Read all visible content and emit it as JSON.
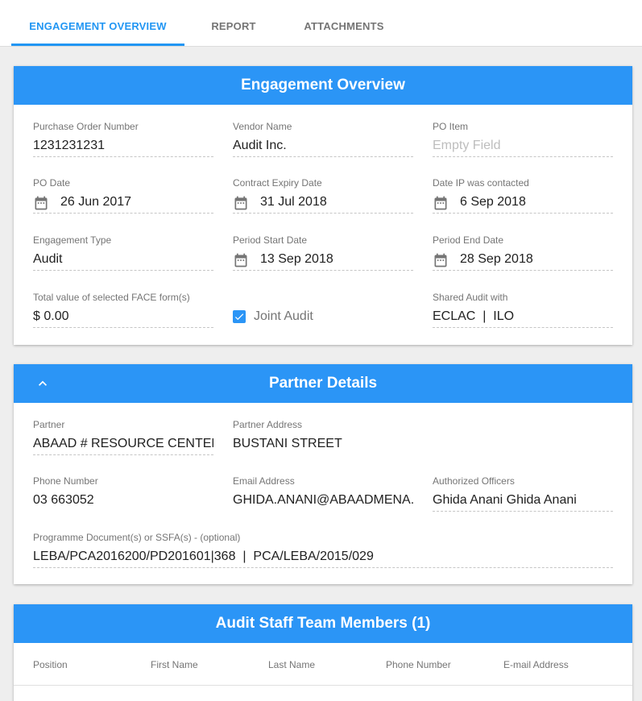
{
  "tabs": [
    {
      "label": "ENGAGEMENT OVERVIEW",
      "active": true
    },
    {
      "label": "REPORT",
      "active": false
    },
    {
      "label": "ATTACHMENTS",
      "active": false
    }
  ],
  "engagement": {
    "title": "Engagement Overview",
    "purchase_order": {
      "label": "Purchase Order Number",
      "value": "1231231231"
    },
    "vendor_name": {
      "label": "Vendor Name",
      "value": "Audit Inc."
    },
    "po_item": {
      "label": "PO Item",
      "placeholder": "Empty Field"
    },
    "po_date": {
      "label": "PO Date",
      "value": "26 Jun 2017"
    },
    "contract_expiry": {
      "label": "Contract Expiry Date",
      "value": "31 Jul 2018"
    },
    "date_ip_contacted": {
      "label": "Date IP was contacted",
      "value": "6 Sep 2018"
    },
    "engagement_type": {
      "label": "Engagement Type",
      "value": "Audit"
    },
    "period_start": {
      "label": "Period Start Date",
      "value": "13 Sep 2018"
    },
    "period_end": {
      "label": "Period End Date",
      "value": "28 Sep 2018"
    },
    "face_total": {
      "label": "Total value of selected FACE form(s)",
      "value": "$ 0.00"
    },
    "joint_audit": {
      "label": "Joint Audit",
      "checked": true
    },
    "shared_audit": {
      "label": "Shared Audit with",
      "value": "ECLAC  |  ILO"
    }
  },
  "partner": {
    "title": "Partner Details",
    "partner": {
      "label": "Partner",
      "value": "ABAAD # RESOURCE CENTER FOR GENDER EQUALITY"
    },
    "address": {
      "label": "Partner Address",
      "value": "BUSTANI STREET"
    },
    "phone": {
      "label": "Phone Number",
      "value": "03 663052"
    },
    "email": {
      "label": "Email Address",
      "value": "GHIDA.ANANI@ABAADMENA.ORG"
    },
    "officers": {
      "label": "Authorized Officers",
      "value": "Ghida Anani Ghida Anani"
    },
    "programme_docs": {
      "label": "Programme Document(s) or SSFA(s) - (optional)",
      "value": "LEBA/PCA2016200/PD201601|368  |  PCA/LEBA/2015/029"
    }
  },
  "staff": {
    "title": "Audit Staff Team Members (1)",
    "columns": [
      "Position",
      "First Name",
      "Last Name",
      "Phone Number",
      "E-mail Address"
    ]
  },
  "colors": {
    "accent": "#2196f3",
    "header": "#2b95f6"
  },
  "icons": {
    "date_field": "calendar-icon",
    "collapse": "chevron-up-icon",
    "checkbox": "check-icon"
  }
}
